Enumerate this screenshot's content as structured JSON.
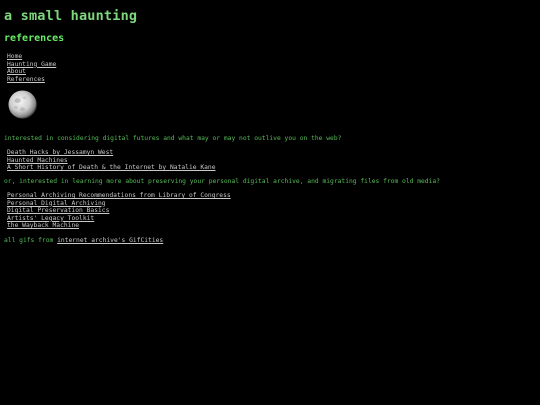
{
  "site": {
    "title": "a small haunting"
  },
  "page": {
    "heading": "references"
  },
  "nav": {
    "items": [
      {
        "label": "Home"
      },
      {
        "label": "Haunting Game"
      },
      {
        "label": "About"
      },
      {
        "label": "References"
      }
    ]
  },
  "moon": {
    "icon": "moon-icon"
  },
  "section1": {
    "intro": "interested in considering digital futures and what may or may not outlive you on the web?",
    "links": [
      {
        "label": "Death Hacks by Jessamyn West"
      },
      {
        "label": "Haunted Machines"
      },
      {
        "label": "A Short History of Death & the Internet by Natalie Kane"
      }
    ]
  },
  "section2": {
    "intro": "or, interested in learning more about preserving your personal digital archive, and migrating files from old media?",
    "links": [
      {
        "label": "Personal Archiving Recommendations from Library of Congress"
      },
      {
        "label": "Personal Digital Archiving"
      },
      {
        "label": "Digital Preservation Basics"
      },
      {
        "label": "Artists' Legacy Toolkit"
      },
      {
        "label": "the Wayback Machine"
      }
    ]
  },
  "credits": {
    "prefix": "all gifs from ",
    "link_label": "internet archive's GifCities"
  },
  "colors": {
    "background": "#000000",
    "title": "#7dd87d",
    "heading": "#66ee66",
    "text": "#55bb55",
    "link": "#c8c8c8"
  }
}
